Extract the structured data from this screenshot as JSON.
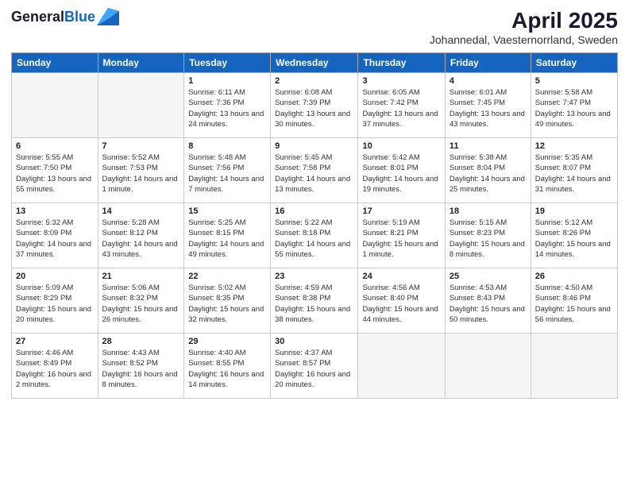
{
  "header": {
    "logo_general": "General",
    "logo_blue": "Blue",
    "title": "April 2025",
    "subtitle": "Johannedal, Vaesternorrland, Sweden"
  },
  "days_of_week": [
    "Sunday",
    "Monday",
    "Tuesday",
    "Wednesday",
    "Thursday",
    "Friday",
    "Saturday"
  ],
  "weeks": [
    [
      {
        "day": "",
        "sunrise": "",
        "sunset": "",
        "daylight": ""
      },
      {
        "day": "",
        "sunrise": "",
        "sunset": "",
        "daylight": ""
      },
      {
        "day": "1",
        "sunrise": "Sunrise: 6:11 AM",
        "sunset": "Sunset: 7:36 PM",
        "daylight": "Daylight: 13 hours and 24 minutes."
      },
      {
        "day": "2",
        "sunrise": "Sunrise: 6:08 AM",
        "sunset": "Sunset: 7:39 PM",
        "daylight": "Daylight: 13 hours and 30 minutes."
      },
      {
        "day": "3",
        "sunrise": "Sunrise: 6:05 AM",
        "sunset": "Sunset: 7:42 PM",
        "daylight": "Daylight: 13 hours and 37 minutes."
      },
      {
        "day": "4",
        "sunrise": "Sunrise: 6:01 AM",
        "sunset": "Sunset: 7:45 PM",
        "daylight": "Daylight: 13 hours and 43 minutes."
      },
      {
        "day": "5",
        "sunrise": "Sunrise: 5:58 AM",
        "sunset": "Sunset: 7:47 PM",
        "daylight": "Daylight: 13 hours and 49 minutes."
      }
    ],
    [
      {
        "day": "6",
        "sunrise": "Sunrise: 5:55 AM",
        "sunset": "Sunset: 7:50 PM",
        "daylight": "Daylight: 13 hours and 55 minutes."
      },
      {
        "day": "7",
        "sunrise": "Sunrise: 5:52 AM",
        "sunset": "Sunset: 7:53 PM",
        "daylight": "Daylight: 14 hours and 1 minute."
      },
      {
        "day": "8",
        "sunrise": "Sunrise: 5:48 AM",
        "sunset": "Sunset: 7:56 PM",
        "daylight": "Daylight: 14 hours and 7 minutes."
      },
      {
        "day": "9",
        "sunrise": "Sunrise: 5:45 AM",
        "sunset": "Sunset: 7:58 PM",
        "daylight": "Daylight: 14 hours and 13 minutes."
      },
      {
        "day": "10",
        "sunrise": "Sunrise: 5:42 AM",
        "sunset": "Sunset: 8:01 PM",
        "daylight": "Daylight: 14 hours and 19 minutes."
      },
      {
        "day": "11",
        "sunrise": "Sunrise: 5:38 AM",
        "sunset": "Sunset: 8:04 PM",
        "daylight": "Daylight: 14 hours and 25 minutes."
      },
      {
        "day": "12",
        "sunrise": "Sunrise: 5:35 AM",
        "sunset": "Sunset: 8:07 PM",
        "daylight": "Daylight: 14 hours and 31 minutes."
      }
    ],
    [
      {
        "day": "13",
        "sunrise": "Sunrise: 5:32 AM",
        "sunset": "Sunset: 8:09 PM",
        "daylight": "Daylight: 14 hours and 37 minutes."
      },
      {
        "day": "14",
        "sunrise": "Sunrise: 5:28 AM",
        "sunset": "Sunset: 8:12 PM",
        "daylight": "Daylight: 14 hours and 43 minutes."
      },
      {
        "day": "15",
        "sunrise": "Sunrise: 5:25 AM",
        "sunset": "Sunset: 8:15 PM",
        "daylight": "Daylight: 14 hours and 49 minutes."
      },
      {
        "day": "16",
        "sunrise": "Sunrise: 5:22 AM",
        "sunset": "Sunset: 8:18 PM",
        "daylight": "Daylight: 14 hours and 55 minutes."
      },
      {
        "day": "17",
        "sunrise": "Sunrise: 5:19 AM",
        "sunset": "Sunset: 8:21 PM",
        "daylight": "Daylight: 15 hours and 1 minute."
      },
      {
        "day": "18",
        "sunrise": "Sunrise: 5:15 AM",
        "sunset": "Sunset: 8:23 PM",
        "daylight": "Daylight: 15 hours and 8 minutes."
      },
      {
        "day": "19",
        "sunrise": "Sunrise: 5:12 AM",
        "sunset": "Sunset: 8:26 PM",
        "daylight": "Daylight: 15 hours and 14 minutes."
      }
    ],
    [
      {
        "day": "20",
        "sunrise": "Sunrise: 5:09 AM",
        "sunset": "Sunset: 8:29 PM",
        "daylight": "Daylight: 15 hours and 20 minutes."
      },
      {
        "day": "21",
        "sunrise": "Sunrise: 5:06 AM",
        "sunset": "Sunset: 8:32 PM",
        "daylight": "Daylight: 15 hours and 26 minutes."
      },
      {
        "day": "22",
        "sunrise": "Sunrise: 5:02 AM",
        "sunset": "Sunset: 8:35 PM",
        "daylight": "Daylight: 15 hours and 32 minutes."
      },
      {
        "day": "23",
        "sunrise": "Sunrise: 4:59 AM",
        "sunset": "Sunset: 8:38 PM",
        "daylight": "Daylight: 15 hours and 38 minutes."
      },
      {
        "day": "24",
        "sunrise": "Sunrise: 4:56 AM",
        "sunset": "Sunset: 8:40 PM",
        "daylight": "Daylight: 15 hours and 44 minutes."
      },
      {
        "day": "25",
        "sunrise": "Sunrise: 4:53 AM",
        "sunset": "Sunset: 8:43 PM",
        "daylight": "Daylight: 15 hours and 50 minutes."
      },
      {
        "day": "26",
        "sunrise": "Sunrise: 4:50 AM",
        "sunset": "Sunset: 8:46 PM",
        "daylight": "Daylight: 15 hours and 56 minutes."
      }
    ],
    [
      {
        "day": "27",
        "sunrise": "Sunrise: 4:46 AM",
        "sunset": "Sunset: 8:49 PM",
        "daylight": "Daylight: 16 hours and 2 minutes."
      },
      {
        "day": "28",
        "sunrise": "Sunrise: 4:43 AM",
        "sunset": "Sunset: 8:52 PM",
        "daylight": "Daylight: 16 hours and 8 minutes."
      },
      {
        "day": "29",
        "sunrise": "Sunrise: 4:40 AM",
        "sunset": "Sunset: 8:55 PM",
        "daylight": "Daylight: 16 hours and 14 minutes."
      },
      {
        "day": "30",
        "sunrise": "Sunrise: 4:37 AM",
        "sunset": "Sunset: 8:57 PM",
        "daylight": "Daylight: 16 hours and 20 minutes."
      },
      {
        "day": "",
        "sunrise": "",
        "sunset": "",
        "daylight": ""
      },
      {
        "day": "",
        "sunrise": "",
        "sunset": "",
        "daylight": ""
      },
      {
        "day": "",
        "sunrise": "",
        "sunset": "",
        "daylight": ""
      }
    ]
  ]
}
